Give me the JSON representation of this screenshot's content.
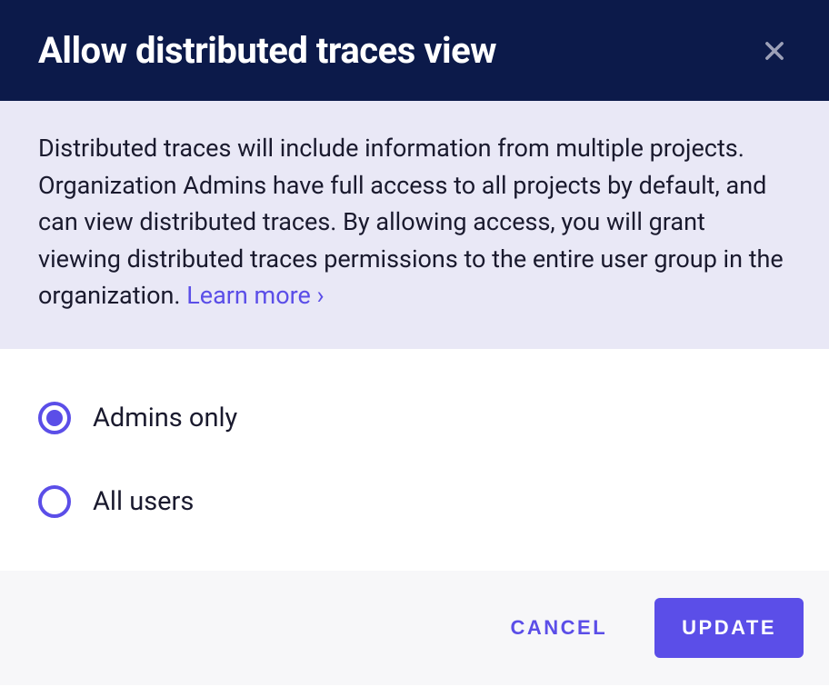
{
  "header": {
    "title": "Allow distributed traces view"
  },
  "description": {
    "text": "Distributed traces will include information from multiple projects. Organization Admins have full access to all projects by default, and can view distributed traces. By allowing access, you will grant viewing distributed traces permissions to the entire user group in the organization. ",
    "learn_more": "Learn more ›"
  },
  "options": [
    {
      "label": "Admins only",
      "selected": true
    },
    {
      "label": "All users",
      "selected": false
    }
  ],
  "footer": {
    "cancel": "CANCEL",
    "update": "UPDATE"
  }
}
